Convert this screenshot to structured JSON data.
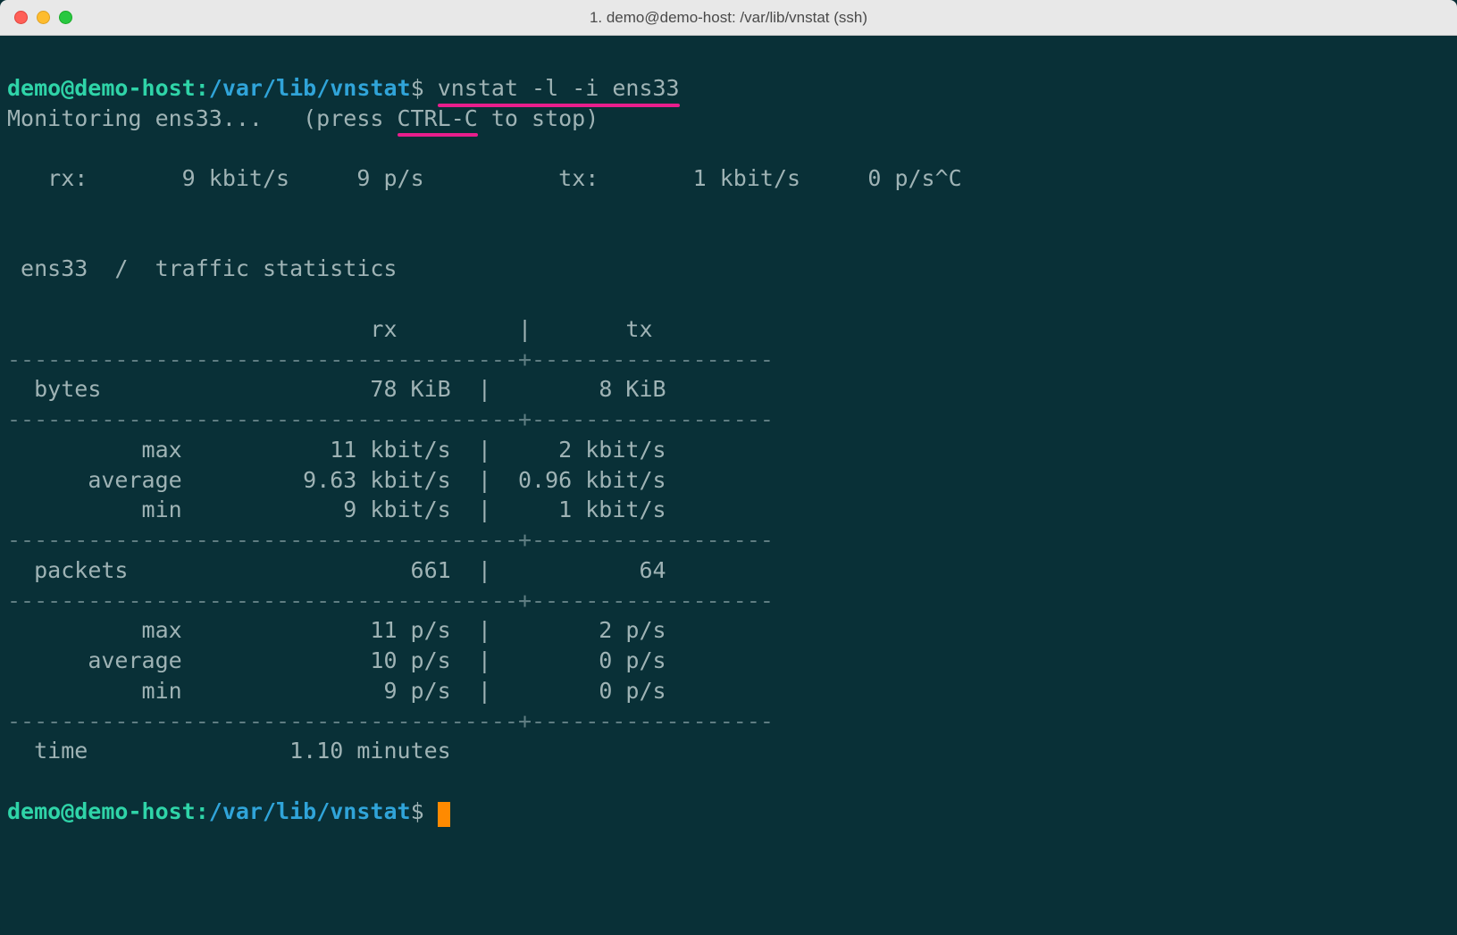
{
  "window": {
    "title": "1. demo@demo-host: /var/lib/vnstat (ssh)"
  },
  "prompt": {
    "user_host": "demo@demo-host",
    "colon": ":",
    "path": "/var/lib/vnstat",
    "dollar": "$"
  },
  "command": "vnstat -l -i ens33",
  "monitor_line_a": "Monitoring ens33...   (press ",
  "monitor_ctrl": "CTRL-C",
  "monitor_line_b": " to stop)",
  "live": {
    "rx_label": "   rx:",
    "rx_rate": "9 kbit/s",
    "rx_pps": "9 p/s",
    "tx_label": "tx:",
    "tx_rate": "1 kbit/s",
    "tx_pps": "0 p/s^C"
  },
  "stats_header": " ens33  /  traffic statistics",
  "col_rx": "rx",
  "col_tx": "tx",
  "rows": {
    "bytes": {
      "label": "bytes",
      "rx": "78 KiB",
      "tx": "8 KiB"
    },
    "bmax": {
      "label": "max",
      "rx": "11 kbit/s",
      "tx": "2 kbit/s"
    },
    "bavg": {
      "label": "average",
      "rx": "9.63 kbit/s",
      "tx": "0.96 kbit/s"
    },
    "bmin": {
      "label": "min",
      "rx": "9 kbit/s",
      "tx": "1 kbit/s"
    },
    "packets": {
      "label": "packets",
      "rx": "661",
      "tx": "64"
    },
    "pmax": {
      "label": "max",
      "rx": "11 p/s",
      "tx": "2 p/s"
    },
    "pavg": {
      "label": "average",
      "rx": "10 p/s",
      "tx": "0 p/s"
    },
    "pmin": {
      "label": "min",
      "rx": "9 p/s",
      "tx": "0 p/s"
    },
    "time": {
      "label": "time",
      "val": "1.10 minutes"
    }
  },
  "hr": "--------------------------------------+------------------",
  "pipe": "|"
}
